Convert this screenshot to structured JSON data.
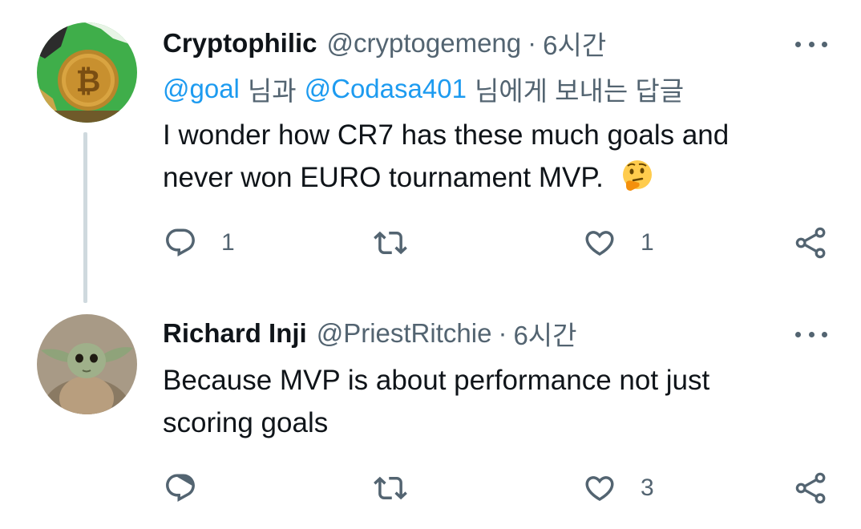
{
  "tweets": [
    {
      "author_name": "Cryptophilic",
      "handle": "@cryptogemeng",
      "separator": "·",
      "time": "6시간",
      "reply_to": {
        "mention1": "@goal",
        "word1": "님과",
        "mention2": "@Codasa401",
        "word2": "님에게 보내는 답글"
      },
      "text": "I wonder how CR7 has these much goals and never won EURO tournament MVP.",
      "emoji": "thinking-face-emoji",
      "reply_count": "1",
      "retweet_count": "",
      "like_count": "1",
      "avatar_icon": "bitcoin-avatar"
    },
    {
      "author_name": "Richard Inji",
      "handle": "@PriestRitchie",
      "separator": "·",
      "time": "6시간",
      "text": "Because MVP is about performance not just scoring goals",
      "reply_count": "",
      "retweet_count": "",
      "like_count": "3",
      "avatar_icon": "baby-yoda-avatar"
    }
  ],
  "colors": {
    "text": "#0f1419",
    "secondary": "#536471",
    "link": "#1d9bf0",
    "thread_line": "#cfd9de"
  },
  "icons": [
    "reply-icon",
    "retweet-icon",
    "like-icon",
    "share-icon",
    "more-icon"
  ]
}
